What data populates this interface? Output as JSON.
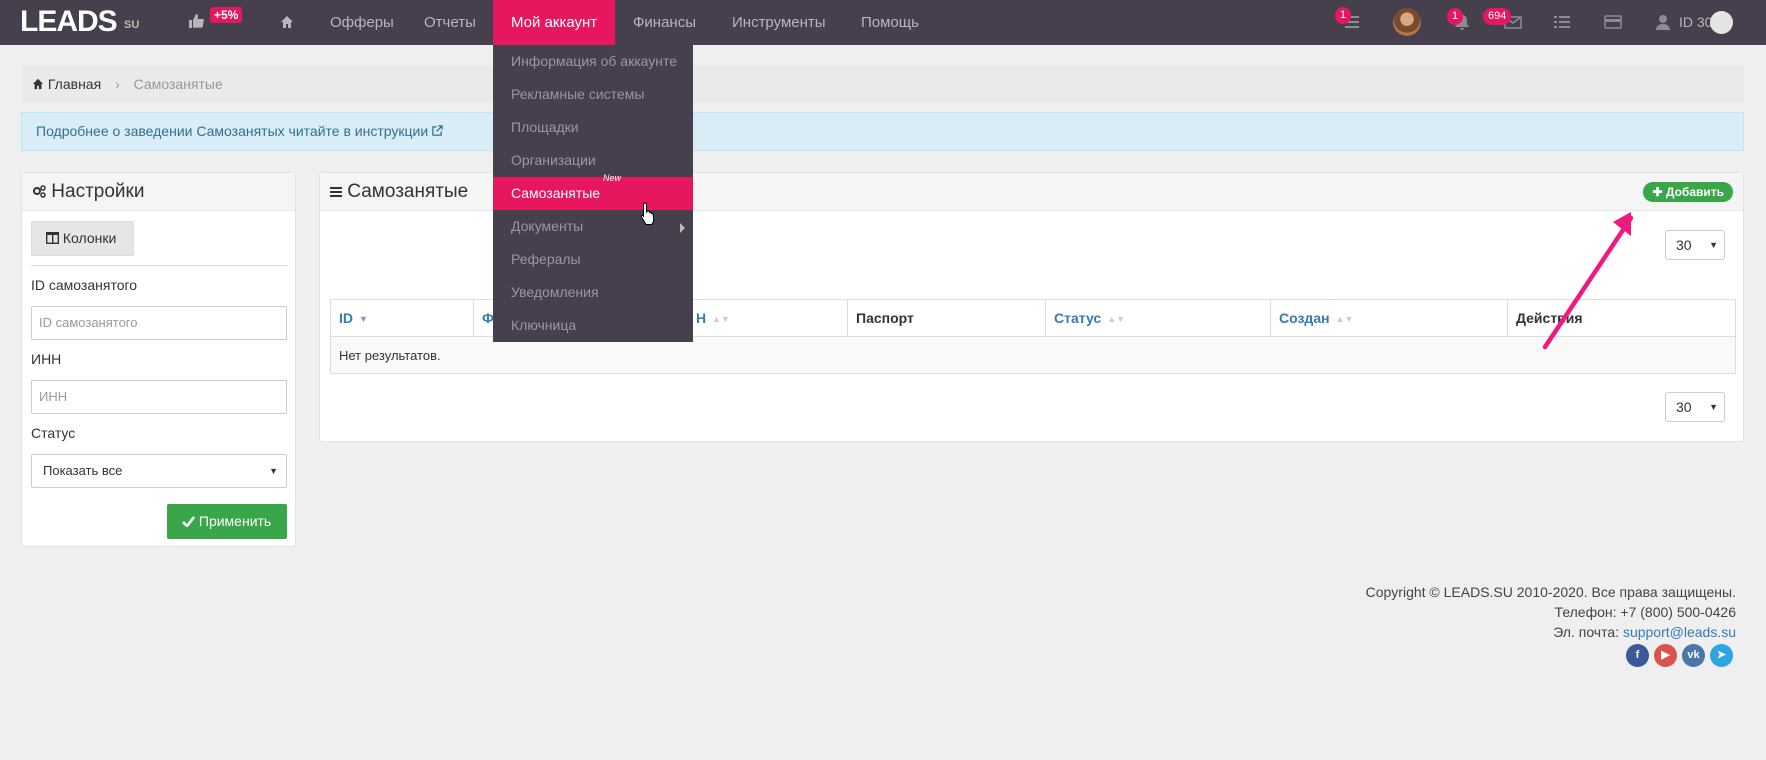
{
  "brand": {
    "logo": "LEADS",
    "logo_suffix": "SU",
    "likes_badge": "+5%"
  },
  "nav": {
    "items": [
      "Офферы",
      "Отчеты",
      "Мой аккаунт",
      "Финансы",
      "Инструменты",
      "Помощь"
    ],
    "active": "Мой аккаунт"
  },
  "toolbar": {
    "tasks_badge": "1",
    "notifications_badge": "1",
    "messages_badge": "694",
    "user_id": "ID 30"
  },
  "dropdown": {
    "items": [
      "Информация об аккаунте",
      "Рекламные системы",
      "Площадки",
      "Организации",
      "Самозанятые",
      "Документы",
      "Рефералы",
      "Уведомления",
      "Ключница"
    ],
    "active": "Самозанятые",
    "new_label": "New"
  },
  "breadcrumb": {
    "home": "Главная",
    "current": "Самозанятые"
  },
  "alert": {
    "text": "Подробнее о заведении Самозанятых читайте в инструкции"
  },
  "settings": {
    "title": "Настройки",
    "columns_button": "Колонки",
    "id_label": "ID самозанятого",
    "id_placeholder": "ID самозанятого",
    "inn_label": "ИНН",
    "inn_placeholder": "ИНН",
    "status_label": "Статус",
    "status_value": "Показать все",
    "apply_button": "Применить"
  },
  "main": {
    "title": "Самозанятые",
    "add_button": "Добавить",
    "per_page": "30",
    "columns": [
      "ID",
      "Ф",
      "Н",
      "Паспорт",
      "Статус",
      "Создан",
      "Действия"
    ],
    "empty_text": "Нет результатов."
  },
  "footer": {
    "copyright": "Copyright © LEADS.SU 2010-2020. Все права защищены.",
    "phone": "Телефон: +7 (800) 500-0426",
    "email_label": "Эл. почта:",
    "email": "support@leads.su"
  },
  "colors": {
    "nav_bg": "#453f4e",
    "accent": "#e7175f",
    "success": "#3aa64a",
    "link": "#337ab7"
  }
}
